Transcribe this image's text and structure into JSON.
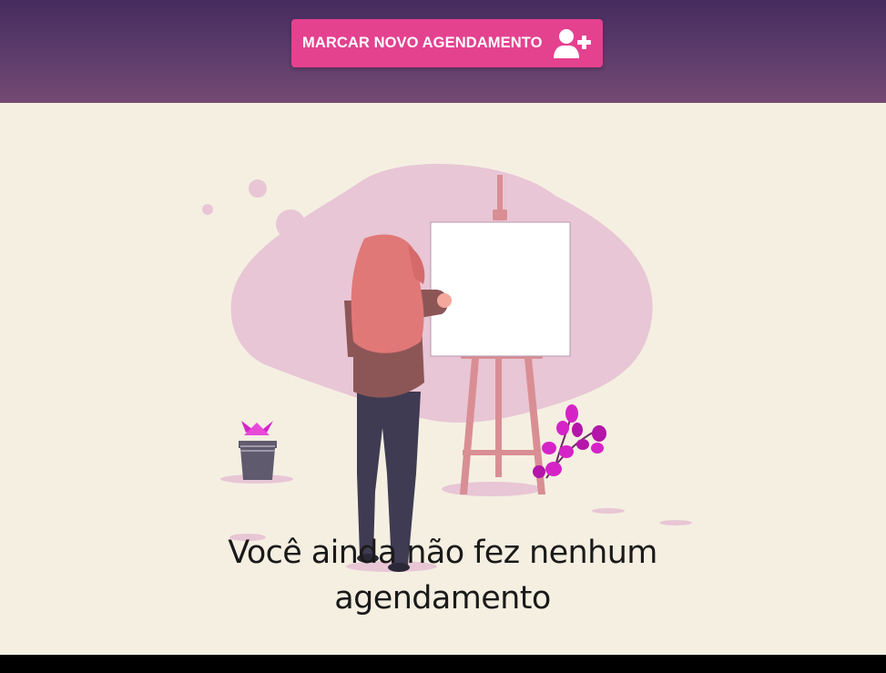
{
  "header": {
    "new_appointment_button": "MARCAR NOVO AGENDAMENTO",
    "button_icon": "user-plus-icon"
  },
  "empty_state": {
    "illustration": "woman-painting-easel-illustration",
    "message": "Você ainda não fez nenhum agendamento"
  },
  "colors": {
    "header_top": "#452c5e",
    "header_bottom": "#744a72",
    "button_accent": "#e4418f",
    "page_background": "#f5efe2",
    "blob": "#e8c6d5",
    "hair": "#e07877",
    "plant": "#d623c8"
  }
}
